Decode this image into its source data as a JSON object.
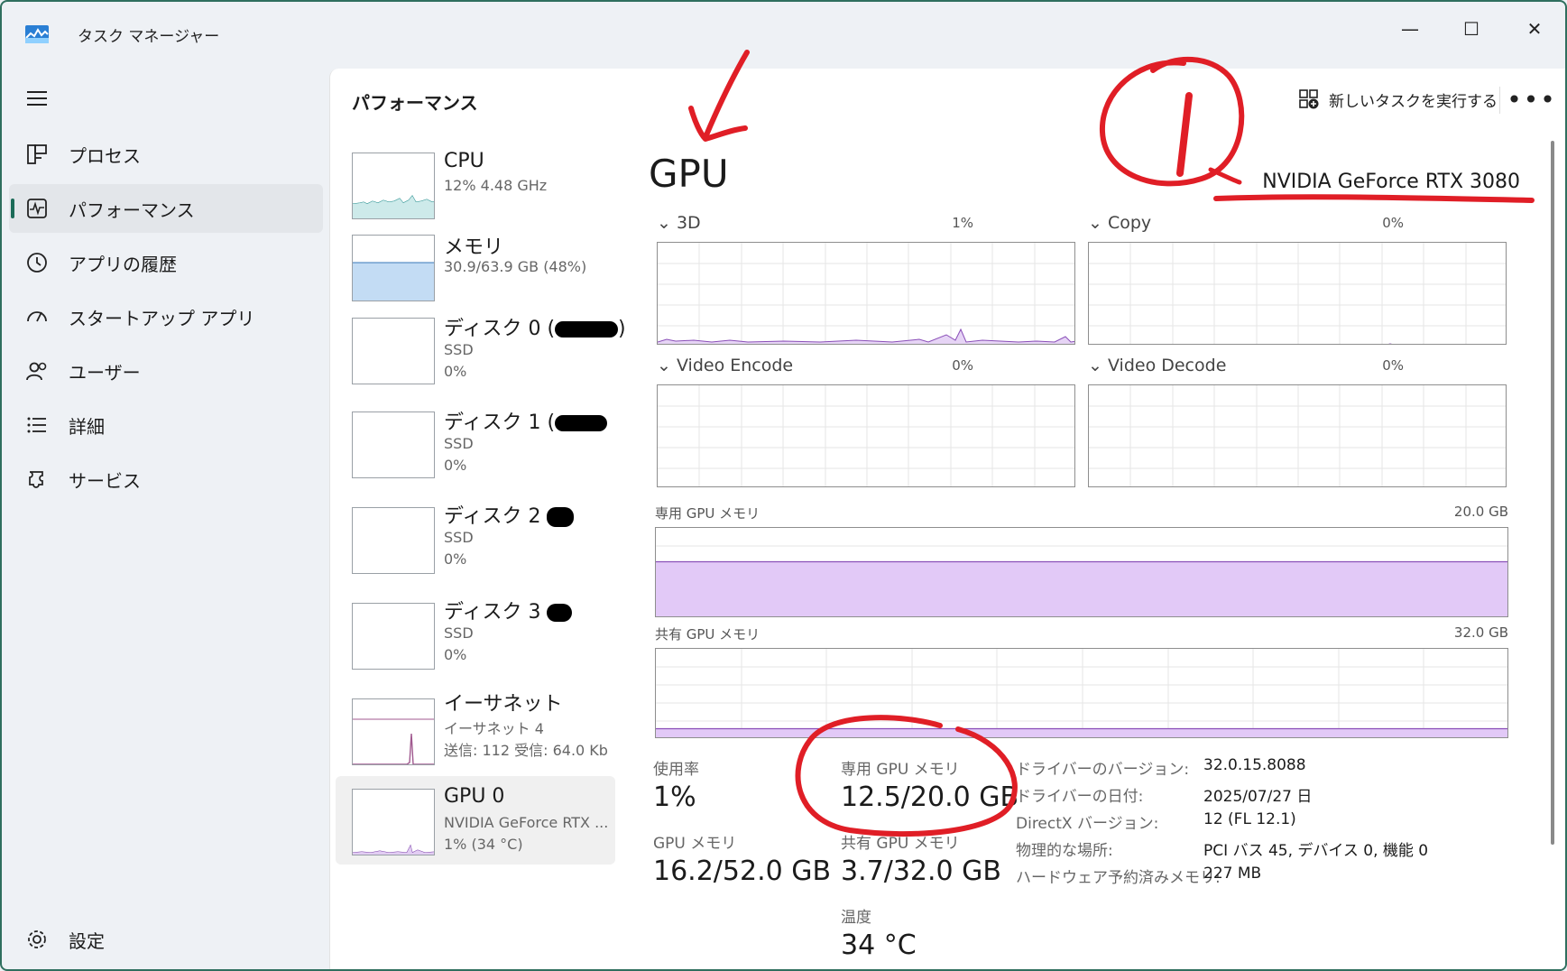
{
  "window": {
    "title": "タスク マネージャー",
    "minimize": "—",
    "maximize": "☐",
    "close": "✕"
  },
  "nav": {
    "items": [
      {
        "label": "プロセス",
        "icon": "processes-icon"
      },
      {
        "label": "パフォーマンス",
        "icon": "performance-icon",
        "active": true
      },
      {
        "label": "アプリの履歴",
        "icon": "history-icon"
      },
      {
        "label": "スタートアップ アプリ",
        "icon": "startup-icon"
      },
      {
        "label": "ユーザー",
        "icon": "users-icon"
      },
      {
        "label": "詳細",
        "icon": "details-icon"
      },
      {
        "label": "サービス",
        "icon": "services-icon"
      }
    ],
    "settings": "設定"
  },
  "header": {
    "title": "パフォーマンス",
    "new_task": "新しいタスクを実行する",
    "more": "•••"
  },
  "devices": [
    {
      "name": "CPU",
      "sub1": "12%  4.48 GHz"
    },
    {
      "name": "メモリ",
      "sub1": "30.9/63.9 GB (48%)"
    },
    {
      "name": "ディスク 0 (",
      "name_end": ")",
      "sub1": "SSD",
      "sub2": "0%"
    },
    {
      "name": "ディスク 1 (",
      "sub1": "SSD",
      "sub2": "0%"
    },
    {
      "name": "ディスク 2",
      "sub1": "SSD",
      "sub2": "0%"
    },
    {
      "name": "ディスク 3",
      "sub1": "SSD",
      "sub2": "0%"
    },
    {
      "name": "イーサネット",
      "sub1": "イーサネット 4",
      "sub2": "送信: 112  受信: 64.0 Kb"
    },
    {
      "name": "GPU 0",
      "sub1": "NVIDIA GeForce RTX ...",
      "sub2": "1%  (34 °C)",
      "active": true
    }
  ],
  "gpu": {
    "title": "GPU",
    "name": "NVIDIA GeForce RTX 3080",
    "engines": [
      {
        "label": "3D",
        "pct": "1%"
      },
      {
        "label": "Copy",
        "pct": "0%"
      },
      {
        "label": "Video Encode",
        "pct": "0%"
      },
      {
        "label": "Video Decode",
        "pct": "0%"
      }
    ],
    "dedicated_label": "専用 GPU メモリ",
    "dedicated_max": "20.0 GB",
    "dedicated_fill": 0.625,
    "shared_label": "共有 GPU メモリ",
    "shared_max": "32.0 GB",
    "shared_fill": 0.115,
    "stats": {
      "usage_label": "使用率",
      "usage_value": "1%",
      "gpu_mem_label": "GPU メモリ",
      "gpu_mem_value": "16.2/52.0 GB",
      "dedicated_label": "専用 GPU メモリ",
      "dedicated_value": "12.5/20.0 GB",
      "shared_label": "共有 GPU メモリ",
      "shared_value": "3.7/32.0 GB",
      "temp_label": "温度",
      "temp_value": "34 °C"
    },
    "info": [
      {
        "label": "ドライバーのバージョン:",
        "value": "32.0.15.8088"
      },
      {
        "label": "ドライバーの日付:",
        "value": "2025/07/27 日"
      },
      {
        "label": "DirectX バージョン:",
        "value": "12 (FL 12.1)"
      },
      {
        "label": "物理的な場所:",
        "value": "PCI バス 45, デバイス 0, 機能 0"
      },
      {
        "label": "ハードウェア予約済みメモリ:",
        "value": "227 MB"
      }
    ]
  },
  "annotation": {
    "label": "1",
    "color": "#e01e26"
  }
}
